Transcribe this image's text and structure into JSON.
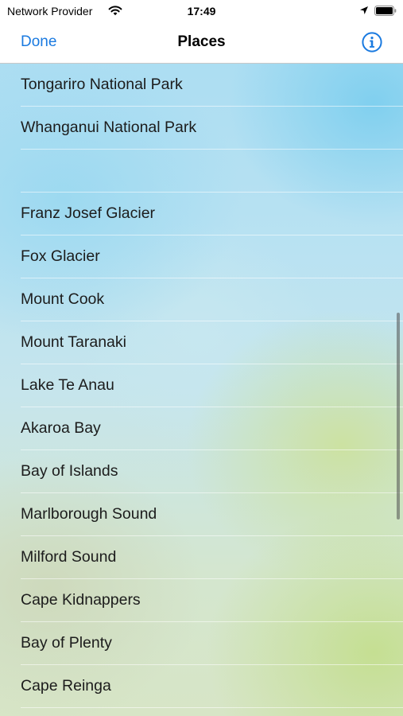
{
  "status_bar": {
    "carrier": "Network Provider",
    "time": "17:49",
    "wifi_icon": "wifi-icon",
    "location_icon": "location-arrow-icon",
    "battery_icon": "battery-icon"
  },
  "nav": {
    "done_label": "Done",
    "title": "Places",
    "info_icon": "info-circle-icon",
    "accent_color": "#1a7ae0"
  },
  "places": {
    "items": [
      "Tongariro National Park",
      "Whanganui National Park",
      "",
      "Franz Josef Glacier",
      "Fox Glacier",
      "Mount Cook",
      "Mount Taranaki",
      "Lake Te Anau",
      "Akaroa Bay",
      "Bay of Islands",
      "Marlborough Sound",
      "Milford Sound",
      "Cape Kidnappers",
      "Bay of Plenty",
      "Cape Reinga"
    ]
  }
}
